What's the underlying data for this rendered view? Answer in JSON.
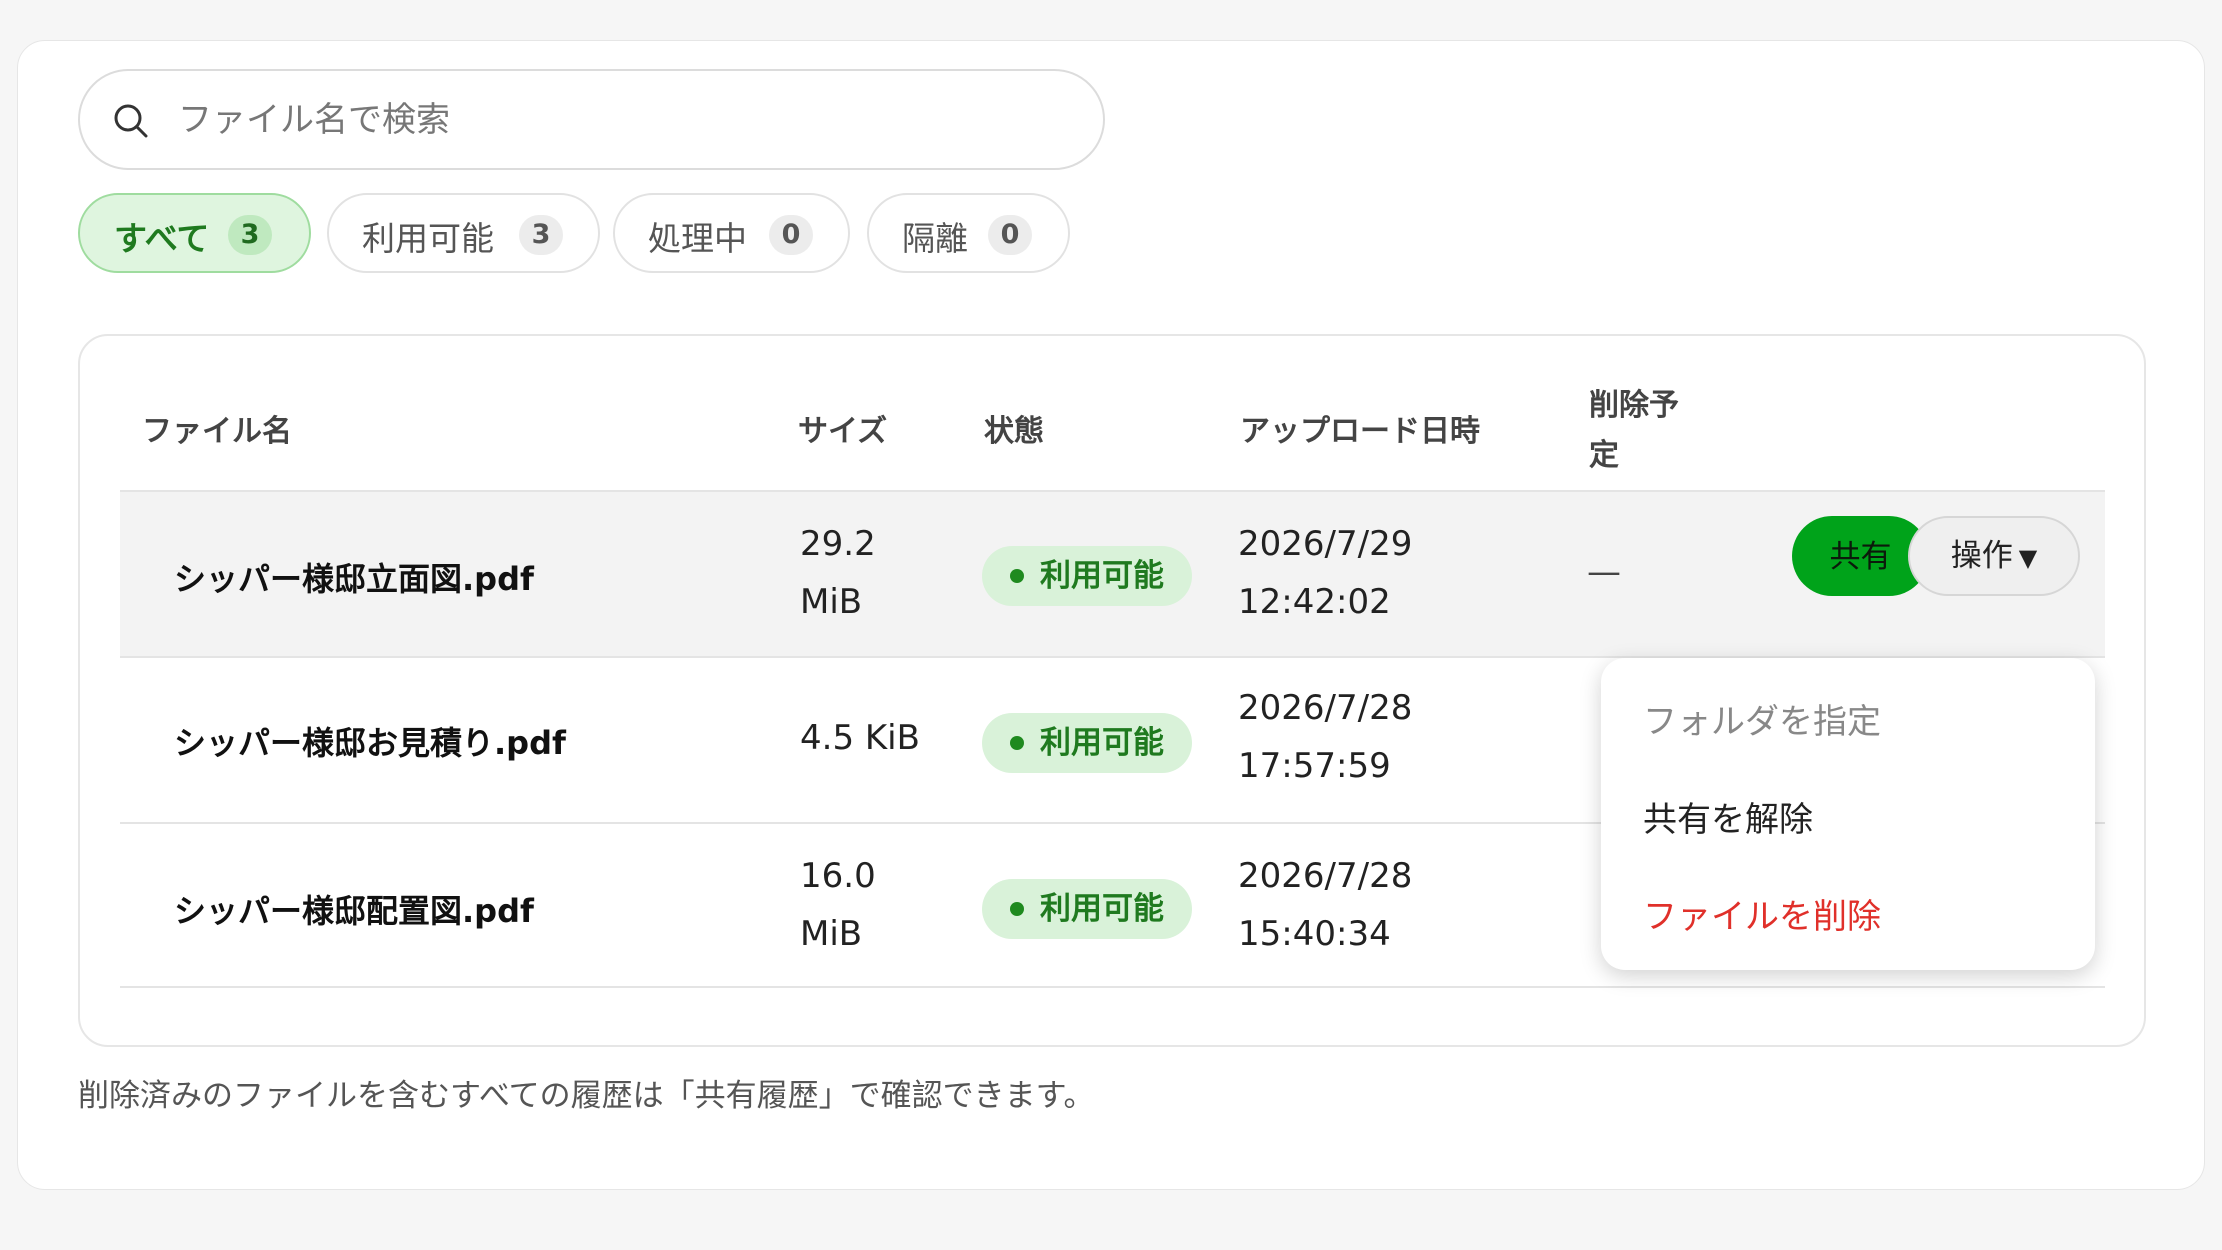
{
  "search": {
    "placeholder": "ファイル名で検索",
    "value": ""
  },
  "filters": [
    {
      "label": "すべて",
      "count": "3",
      "active": true
    },
    {
      "label": "利用可能",
      "count": "3",
      "active": false
    },
    {
      "label": "処理中",
      "count": "0",
      "active": false
    },
    {
      "label": "隔離",
      "count": "0",
      "active": false
    }
  ],
  "table": {
    "headers": {
      "name": "ファイル名",
      "size": "サイズ",
      "status": "状態",
      "uploaded": "アップロード日時",
      "delete_line1": "削除予",
      "delete_line2": "定"
    },
    "rows": [
      {
        "name": "シッパー様邸立面図.pdf",
        "size_line1": "29.2",
        "size_line2": "MiB",
        "status": "利用可能",
        "date": "2026/7/29",
        "time": "12:42:02",
        "delete": "—"
      },
      {
        "name": "シッパー様邸お見積り.pdf",
        "size_line1": "4.5 KiB",
        "size_line2": "",
        "status": "利用可能",
        "date": "2026/7/28",
        "time": "17:57:59",
        "delete": ""
      },
      {
        "name": "シッパー様邸配置図.pdf",
        "size_line1": "16.0",
        "size_line2": "MiB",
        "status": "利用可能",
        "date": "2026/7/28",
        "time": "15:40:34",
        "delete": ""
      }
    ],
    "share_label": "共有",
    "ops_label": "操作",
    "ops_caret": "▼"
  },
  "menu": {
    "items": [
      {
        "label": "フォルダを指定",
        "style": "disabled"
      },
      {
        "label": "共有を解除",
        "style": "normal"
      },
      {
        "label": "ファイルを削除",
        "style": "danger"
      }
    ]
  },
  "footnote": "削除済みのファイルを含むすべての履歴は「共有履歴」で確認できます。",
  "colors": {
    "accent_green": "#00a31a",
    "status_green": "#1f7a1f",
    "danger_red": "#e0302a"
  }
}
